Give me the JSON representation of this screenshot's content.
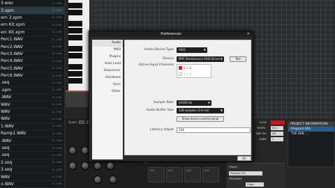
{
  "browser": {
    "files": [
      {
        "name": "3.wav",
        "size": "11.1 KB"
      },
      {
        "name": "3.xpm",
        "size": "11.1 KB"
      },
      {
        "name": "ern 3.xpm",
        "size": "11.1 KB"
      },
      {
        "name": "ern Kit.xpm",
        "size": "11.1 KB"
      },
      {
        "name": "erc Kit.xpm",
        "size": "11.1 KB"
      },
      {
        "name": "Perc1.WAV",
        "size": "11.1 KB"
      },
      {
        "name": "Perc2.WAV",
        "size": "11.1 KB"
      },
      {
        "name": "Perc3.WAV",
        "size": "11.1 KB"
      },
      {
        "name": "Perc4.WAV",
        "size": "11.1 KB"
      },
      {
        "name": "Perc5.WAV",
        "size": "11.1 KB"
      },
      {
        "name": "Perc6.WAV",
        "size": "11.1 KB"
      },
      {
        "name": ".seq",
        "size": "11.1 KB"
      },
      {
        "name": ".xpm",
        "size": "11.1 KB"
      },
      {
        "name": ".WAV",
        "size": "11.1 KB"
      },
      {
        "name": "WAV",
        "size": "11.1 KB"
      },
      {
        "name": "WAV",
        "size": "11.1 KB"
      },
      {
        "name": "WAV",
        "size": "11.1 KB"
      },
      {
        "name": "1.WAV",
        "size": "11.1 KB"
      },
      {
        "name": "Ramp1.WAV",
        "size": "11.1 KB"
      },
      {
        "name": ".WAV",
        "size": "11.1 KB"
      },
      {
        "name": ".seq",
        "size": "11.1 KB"
      },
      {
        "name": ".seq",
        "size": "11.1 KB"
      },
      {
        "name": "2.seq",
        "size": "11.1 KB"
      },
      {
        "name": "3.seq",
        "size": "11.1 KB"
      },
      {
        "name": "WAV",
        "size": "11.1 KB"
      },
      {
        "name": "x.WAV",
        "size": "11.1 KB"
      }
    ]
  },
  "lower": {
    "quantize_label": "Quant",
    "pads": [
      "A01",
      "A02",
      "A03",
      "A04",
      "A05"
    ]
  },
  "transport": {
    "loop_label": "LOOP",
    "tempo_label": "TEMPO",
    "tempo_value": "92.0",
    "sig_label": "TIME SIG",
    "sig_value": "4/4",
    "bars_label": "BARS",
    "bars_value": "2",
    "track_title": "TRACK",
    "track_name": "Program 001",
    "track_program_label": "PROGRAM",
    "track_plugin": "Plugin"
  },
  "project": {
    "title": "PROJECT INFORMATION",
    "items": [
      "Program 001",
      "THE 808 ..."
    ]
  },
  "preferences": {
    "title": "Preferences",
    "nav": [
      "Audio",
      "MIDI",
      "Plugins",
      "Auto Load",
      "Sequencer",
      "Hardware",
      "Sync",
      "Other"
    ],
    "active_nav": "Audio",
    "device_type_label": "Audio Device Type",
    "device_type_value": "ASIO",
    "device_label": "Device",
    "device_value": "MPC Renaissance ASIO Driver",
    "test_label": "Test",
    "channels_label": "Active Input Channels",
    "channels": [
      {
        "label": "1 + 2",
        "checked": true
      },
      {
        "label": "3 + 4",
        "checked": false
      }
    ],
    "sample_rate_label": "Sample Rate",
    "sample_rate_value": "44100 Hz",
    "buffer_label": "Audio Buffer Size",
    "buffer_value": "128 samples (2.9 ms)",
    "control_panel_label": "Show device control panel",
    "latency_label": "Latency Adjust",
    "latency_value": "128",
    "ok_label": "Ok"
  },
  "colors": {
    "accent_red": "#c42020",
    "selection_blue": "#2d5c8a"
  }
}
